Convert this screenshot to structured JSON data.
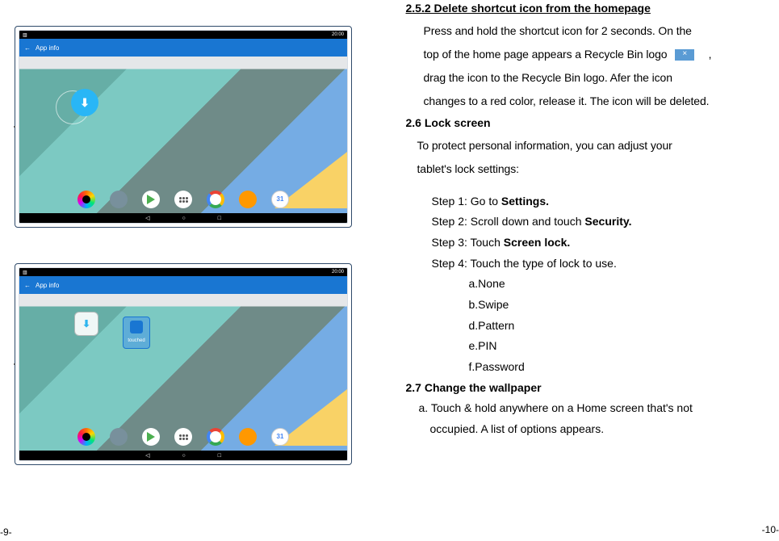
{
  "pageLeftNum": "-9-",
  "pageRightNum": "-10-",
  "tablets": {
    "statusLeft": "▥",
    "statusRight": "20:00",
    "appInfoBack": "←",
    "appInfoTitle": "App info",
    "navBack": "◁",
    "navHome": "○",
    "navRecent": "□",
    "calDay": "31",
    "centerIcon": "⬇",
    "dropLabel": "touched"
  },
  "section252": {
    "heading": "2.5.2 Delete shortcut icon from the homepage",
    "p1a": "Press and hold the shortcut icon for 2 seconds. On the",
    "p1b": "top of the  home page appears a Recycle Bin logo",
    "p1c": ",",
    "p2": "drag the icon to the Recycle Bin logo. Afer the icon",
    "p3": "changes to a red color, release it. The icon will be deleted."
  },
  "section26": {
    "heading": "2.6 Lock screen",
    "intro1": "To protect personal information, you can adjust your",
    "intro2": "tablet's lock settings:",
    "step1_pre": "Step 1: Go to ",
    "step1_bold": "Settings.",
    "step2_pre": "Step 2: Scroll down and touch ",
    "step2_bold": "Security.",
    "step3_pre": "Step 3: Touch ",
    "step3_bold": "Screen lock.",
    "step4": "Step 4: Touch the type of lock to use.",
    "opts": {
      "a": "a.None",
      "b": "b.Swipe",
      "d": "d.Pattern",
      "e": "e.PIN",
      "f": "f.Password"
    }
  },
  "section27": {
    "heading": "2.7 Change the wallpaper",
    "a1": "a. Touch & hold anywhere on a Home screen that's not",
    "a2": "occupied. A list of options appears."
  }
}
